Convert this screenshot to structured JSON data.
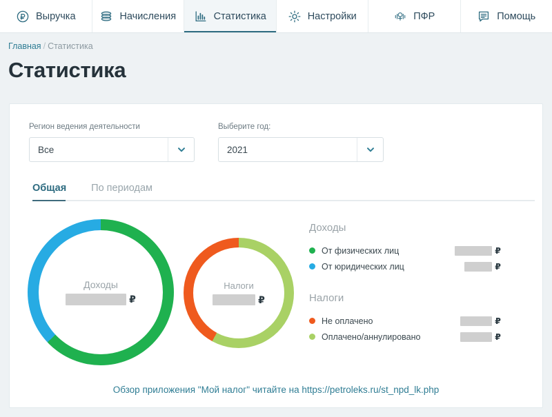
{
  "nav": {
    "items": [
      {
        "label": "Выручка",
        "icon": "ruble-circle-icon",
        "active": false
      },
      {
        "label": "Начисления",
        "icon": "coins-stack-icon",
        "active": false
      },
      {
        "label": "Статистика",
        "icon": "bar-chart-icon",
        "active": true
      },
      {
        "label": "Настройки",
        "icon": "gear-icon",
        "active": false
      },
      {
        "label": "ПФР",
        "icon": "pfr-logo-icon",
        "active": false
      },
      {
        "label": "Помощь",
        "icon": "chat-lines-icon",
        "active": false
      }
    ]
  },
  "breadcrumb": {
    "home": "Главная",
    "separator": "/",
    "current": "Статистика"
  },
  "page": {
    "title": "Статистика"
  },
  "filters": {
    "region": {
      "label": "Регион ведения деятельности",
      "value": "Все",
      "caret": "chevron-down-icon"
    },
    "year": {
      "label": "Выберите год:",
      "value": "2021",
      "caret": "chevron-down-icon"
    }
  },
  "tabs": [
    {
      "label": "Общая",
      "active": true
    },
    {
      "label": "По периодам",
      "active": false
    }
  ],
  "chart_data": [
    {
      "type": "pie",
      "title": "Доходы",
      "center_label": "Доходы",
      "center_value_redacted": true,
      "currency_symbol": "₽",
      "legend_position": "right",
      "categories": [
        "От физических лиц",
        "От юридических лиц"
      ],
      "values": [
        63,
        37
      ],
      "colors": [
        "#1fb14f",
        "#27abe3"
      ],
      "hole_ratio": 0.85
    },
    {
      "type": "pie",
      "title": "Налоги",
      "center_label": "Налоги",
      "center_value_redacted": true,
      "currency_symbol": "₽",
      "legend_position": "right",
      "categories": [
        "Оплачено/аннулировано",
        "Не оплачено"
      ],
      "values": [
        58,
        42
      ],
      "colors": [
        "#a9d165",
        "#ef5a1e"
      ],
      "hole_ratio": 0.82
    }
  ],
  "legend": {
    "income": {
      "title": "Доходы",
      "rows": [
        {
          "label": "От физических лиц",
          "color": "#1fb14f",
          "value_redacted": true,
          "value_width": 54,
          "currency": "₽"
        },
        {
          "label": "От юридических лиц",
          "color": "#27abe3",
          "value_redacted": true,
          "value_width": 40,
          "currency": "₽"
        }
      ]
    },
    "taxes": {
      "title": "Налоги",
      "rows": [
        {
          "label": "Не оплачено",
          "color": "#ef5a1e",
          "value_redacted": true,
          "value_width": 46,
          "currency": "₽"
        },
        {
          "label": "Оплачено/аннулировано",
          "color": "#a9d165",
          "value_redacted": true,
          "value_width": 46,
          "currency": "₽"
        }
      ]
    }
  },
  "footer": {
    "text_before": "Обзор приложения \"Мой налог\" читайте на ",
    "url": "https://petroleks.ru/st_npd_lk.php"
  },
  "colors": {
    "accent": "#2d6b80",
    "link": "#2f7d94",
    "page_bg": "#eef2f4",
    "card_bg": "#ffffff",
    "redact_gray": "#cfcfcf"
  }
}
